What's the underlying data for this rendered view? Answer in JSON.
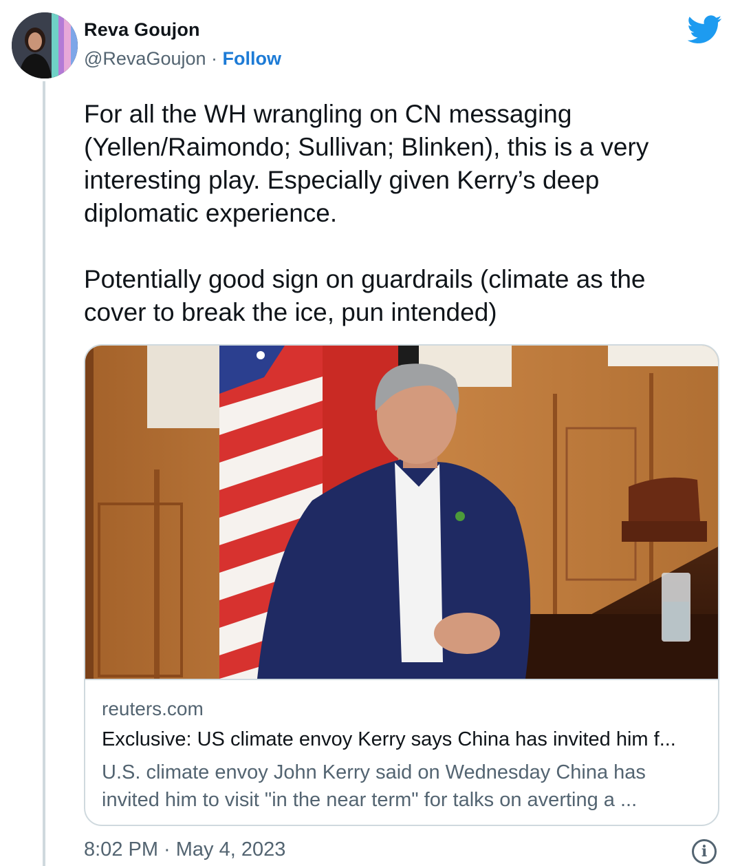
{
  "author": {
    "name": "Reva Goujon",
    "handle": "@RevaGoujon",
    "separator": "·",
    "follow_label": "Follow",
    "avatar_icon": "profile-photo"
  },
  "brand_icon": "twitter-bird-icon",
  "colors": {
    "brand": "#1d9bf0",
    "follow": "#1d7bd6",
    "secondary_text": "#536471"
  },
  "tweet": {
    "paragraphs": [
      "For all the WH wrangling on CN messaging (Yellen/Raimondo; Sullivan; Blinken), this is a very interesting play. Especially given Kerry’s deep diplomatic experience.",
      "Potentially good sign on guardrails (climate as the cover to break the ice, pun intended)"
    ]
  },
  "link_card": {
    "domain": "reuters.com",
    "title": "Exclusive: US climate envoy Kerry says China has invited him f...",
    "description": "U.S. climate envoy John Kerry said on Wednesday China has invited him to visit \"in the near term\" for talks on averting a ..."
  },
  "footer": {
    "timestamp": "8:02 PM · May 4, 2023",
    "info_icon": "info-icon"
  }
}
